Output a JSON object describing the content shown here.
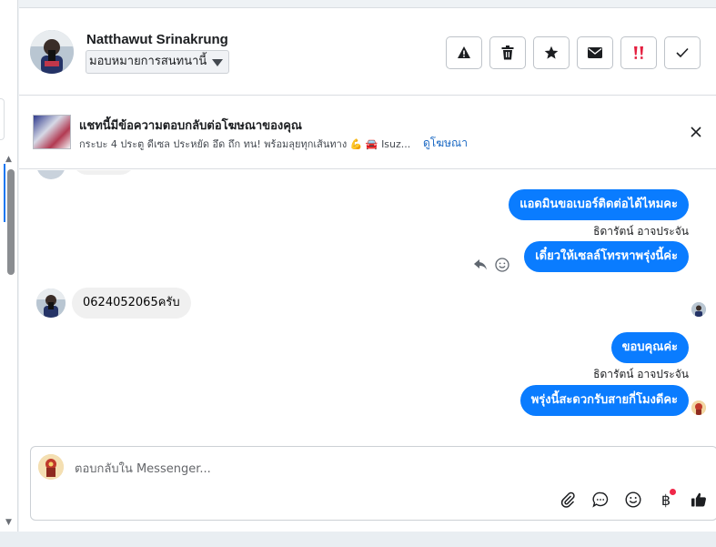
{
  "header": {
    "contact_name": "Natthawut Srinakrung",
    "assign_label": "มอบหมายการสนทนานี้",
    "actions": [
      {
        "icon": "warning-icon",
        "name": "spam-button"
      },
      {
        "icon": "trash-icon",
        "name": "delete-button"
      },
      {
        "icon": "star-icon",
        "name": "star-button"
      },
      {
        "icon": "mail-icon",
        "name": "mark-unread-button"
      },
      {
        "icon": "follow-up-icon",
        "name": "follow-up-button"
      },
      {
        "icon": "check-icon",
        "name": "mark-done-button"
      }
    ]
  },
  "ad_banner": {
    "title": "แชทนี้มีข้อความตอบกลับต่อโฆษณาของคุณ",
    "subtitle": "กระบะ 4 ประตู ดีเซล ประหยัด อึด ถึก ทน! พร้อมลุยทุกเส้นทาง 💪 🚘 Isuz...",
    "link": "ดูโฆษณา"
  },
  "messages": {
    "out_1": "แอดมินขอเบอร์ติดต่อได้ไหมคะ",
    "sender_1": "ธิดารัตน์ อาจประจัน",
    "out_2": "เดี๋ยวให้เซลล์โทรหาพรุ่งนี้ค่ะ",
    "in_1": "0624052065ครับ",
    "out_3": "ขอบคุณค่ะ",
    "sender_2": "ธิดารัตน์ อาจประจัน",
    "out_4": "พรุ่งนี้สะดวกรับสายกี่โมงดีคะ"
  },
  "composer": {
    "placeholder": "ตอบกลับใน Messenger..."
  },
  "colors": {
    "outgoing_bubble": "#0a7cff",
    "incoming_bubble": "#f0f0f0",
    "link": "#1766c2",
    "follow_up_red": "#e41e3f"
  }
}
